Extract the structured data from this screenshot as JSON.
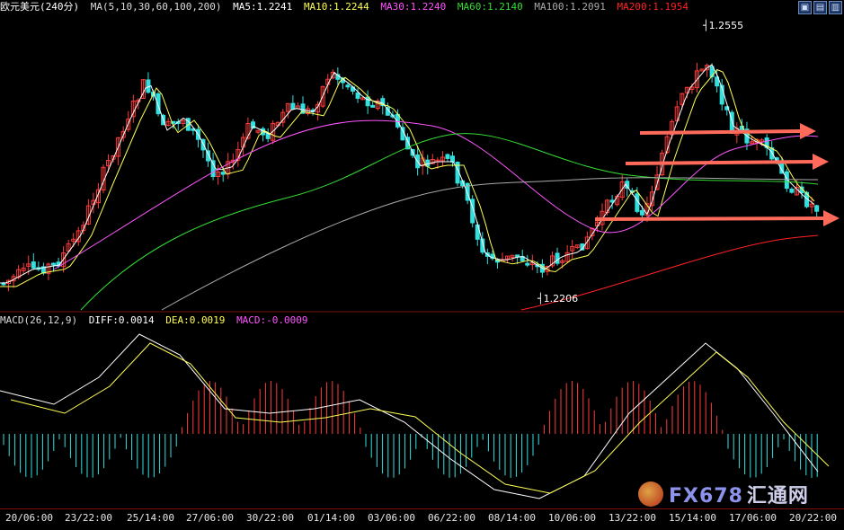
{
  "header": {
    "title": "欧元美元(240分)",
    "ma_label": "MA(5,10,30,60,100,200)",
    "ma5": "MA5:1.2241",
    "ma10": "MA10:1.2244",
    "ma30": "MA30:1.2240",
    "ma60": "MA60:1.2140",
    "ma100": "MA100:1.2091",
    "ma200": "MA200:1.1954"
  },
  "macd": {
    "label": "MACD(26,12,9)",
    "diff": "DIFF:0.0014",
    "dea": "DEA:0.0019",
    "macd": "MACD:-0.0009"
  },
  "annotations": {
    "high": "1.2555",
    "low": "1.2206"
  },
  "window_buttons": [
    "▣",
    "▤",
    "▥"
  ],
  "x_labels": [
    "20/06:00",
    "23/22:00",
    "25/14:00",
    "27/06:00",
    "30/22:00",
    "01/14:00",
    "03/06:00",
    "06/22:00",
    "08/14:00",
    "10/06:00",
    "13/22:00",
    "15/14:00",
    "17/06:00",
    "20/22:00"
  ],
  "watermark": {
    "en": "FX678",
    "cn": "汇通网"
  },
  "colors": {
    "up": "#ff3b3b",
    "down": "#33e0e0",
    "ma5": "#ffffff",
    "ma10": "#ffff55",
    "ma30": "#ff55ff",
    "ma60": "#33dd33",
    "ma100": "#aaaaaa",
    "ma200": "#ff2222",
    "arrow": "#ff6a5a"
  },
  "chart_data": {
    "type": "candlestick",
    "macd_hist_sign": [
      "-",
      "-",
      "-",
      "+",
      "+",
      "+",
      "-",
      "-",
      "-",
      "+",
      "+",
      "+",
      "-",
      "-"
    ]
  }
}
